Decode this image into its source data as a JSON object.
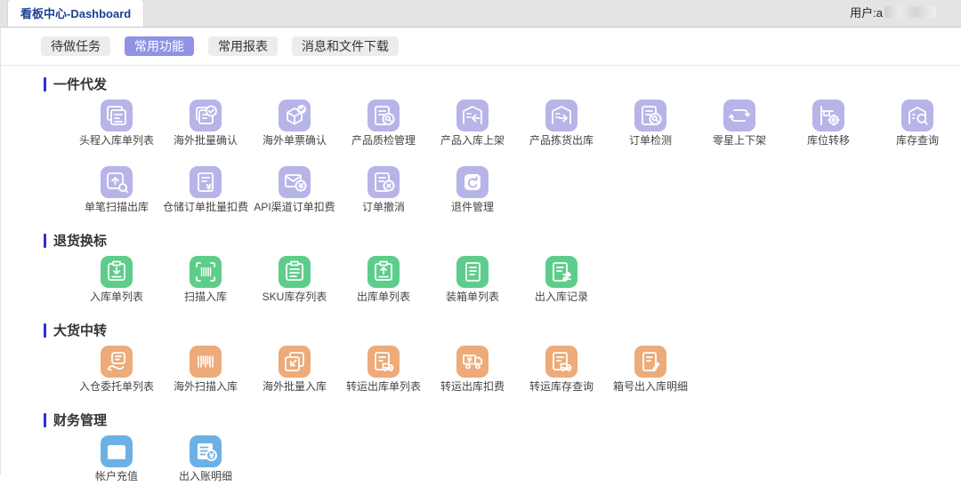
{
  "window": {
    "title": "看板中心-Dashboard",
    "user_label": "用户:a"
  },
  "colors": {
    "active_tab": "#8e93e6",
    "section_marker": "#2f2fd6",
    "dropshipping": "#b7b4e8",
    "return_relabel": "#5ecd8b",
    "bulk_transfer": "#ecab79",
    "finance": "#6cb1e6"
  },
  "tabs": [
    {
      "name": "tab-todo-tasks",
      "label": "待做任务",
      "active": false
    },
    {
      "name": "tab-common-functions",
      "label": "常用功能",
      "active": true
    },
    {
      "name": "tab-common-reports",
      "label": "常用报表",
      "active": false
    },
    {
      "name": "tab-messages-and-downloads",
      "label": "消息和文件下载",
      "active": false
    }
  ],
  "sections": [
    {
      "name": "section-dropshipping",
      "title": "一件代发",
      "color": "#b7b4e8",
      "items": [
        {
          "label": "头程入库单列表",
          "icon": "stacked-documents-icon"
        },
        {
          "label": "海外批量确认",
          "icon": "stacked-documents-check-icon"
        },
        {
          "label": "海外单票确认",
          "icon": "package-check-icon"
        },
        {
          "label": "产品质检管理",
          "icon": "document-inspect-icon"
        },
        {
          "label": "产品入库上架",
          "icon": "warehouse-arrow-in-icon"
        },
        {
          "label": "产品拣货出库",
          "icon": "warehouse-arrow-out-icon"
        },
        {
          "label": "订单检测",
          "icon": "document-inspect-icon"
        },
        {
          "label": "零星上下架",
          "icon": "loop-arrows-icon"
        },
        {
          "label": "库位转移",
          "icon": "shelf-gear-icon"
        },
        {
          "label": "库存查询",
          "icon": "warehouse-search-icon"
        },
        {
          "label": "单笔扫描出库",
          "icon": "box-arrow-up-search-icon"
        },
        {
          "label": "仓储订单批量扣费",
          "icon": "document-yen-icon"
        },
        {
          "label": "API渠道订单扣费",
          "icon": "envelope-yen-icon"
        },
        {
          "label": "订单撤消",
          "icon": "document-cancel-icon"
        },
        {
          "label": "退件管理",
          "icon": "return-arrow-icon"
        }
      ]
    },
    {
      "name": "section-return-relabel",
      "title": "退货换标",
      "color": "#5ecd8b",
      "items": [
        {
          "label": "入库单列表",
          "icon": "clipboard-arrow-down-icon"
        },
        {
          "label": "扫描入库",
          "icon": "scan-barcode-icon"
        },
        {
          "label": "SKU库存列表",
          "icon": "clipboard-list-icon"
        },
        {
          "label": "出库单列表",
          "icon": "clipboard-arrow-up-icon"
        },
        {
          "label": "装箱单列表",
          "icon": "document-lines-icon"
        },
        {
          "label": "出入库记录",
          "icon": "document-swap-icon"
        }
      ]
    },
    {
      "name": "section-bulk-transfer",
      "title": "大货中转",
      "color": "#ecab79",
      "items": [
        {
          "label": "入仓委托单列表",
          "icon": "hand-document-icon"
        },
        {
          "label": "海外扫描入库",
          "icon": "barcode-icon"
        },
        {
          "label": "海外批量入库",
          "icon": "stacked-arrow-in-icon"
        },
        {
          "label": "转运出库单列表",
          "icon": "document-truck-icon"
        },
        {
          "label": "转运出库扣费",
          "icon": "truck-yen-icon"
        },
        {
          "label": "转运库存查询",
          "icon": "document-truck-icon"
        },
        {
          "label": "箱号出入库明细",
          "icon": "document-pencil-icon"
        }
      ]
    },
    {
      "name": "section-finance",
      "title": "财务管理",
      "color": "#6cb1e6",
      "items": [
        {
          "label": "帐户充值",
          "icon": "wallet-icon"
        },
        {
          "label": "出入账明细",
          "icon": "ledger-yen-icon"
        }
      ]
    }
  ]
}
